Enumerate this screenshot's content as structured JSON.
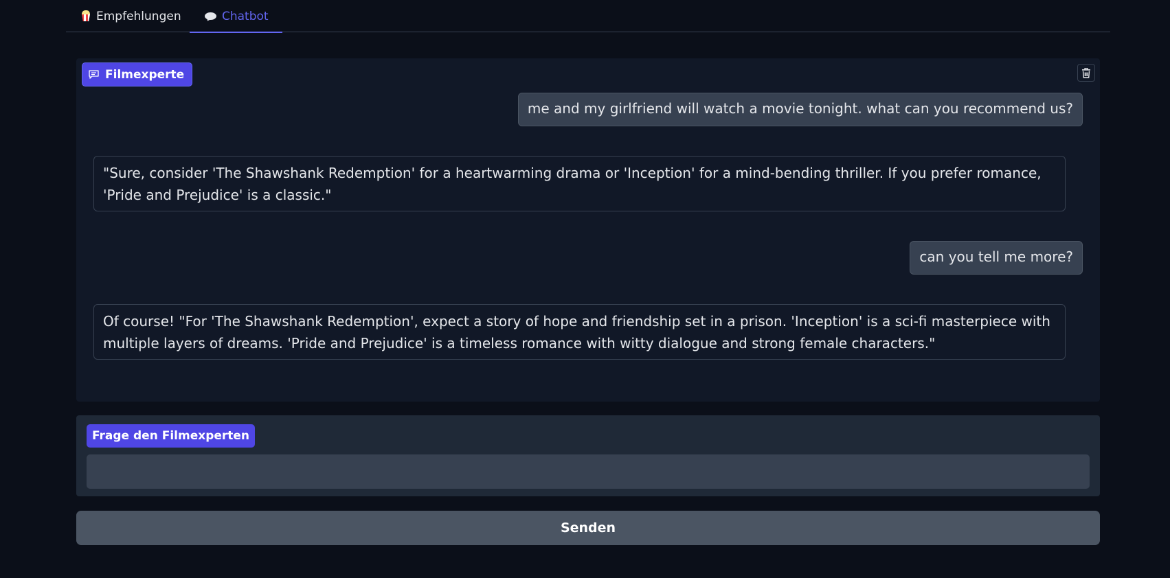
{
  "tabs": [
    {
      "label": "Empfehlungen",
      "icon": "popcorn-icon",
      "active": false
    },
    {
      "label": "Chatbot",
      "icon": "speech-bubble-icon",
      "active": true
    }
  ],
  "chatbot": {
    "label": "Filmexperte",
    "label_icon": "chat-icon",
    "clear_icon": "trash-icon",
    "messages": [
      {
        "role": "user",
        "text": "me and my girlfriend will watch a movie tonight. what can you recommend us?"
      },
      {
        "role": "bot",
        "text": "\"Sure, consider 'The Shawshank Redemption' for a heartwarming drama or 'Inception' for a mind-bending thriller. If you prefer romance, 'Pride and Prejudice' is a classic.\""
      },
      {
        "role": "user",
        "text": "can you tell me more?"
      },
      {
        "role": "bot",
        "text": "Of course! \"For 'The Shawshank Redemption', expect a story of hope and friendship set in a prison. 'Inception' is a sci-fi masterpiece with multiple layers of dreams. 'Pride and Prejudice' is a timeless romance with witty dialogue and strong female characters.\""
      }
    ]
  },
  "question": {
    "label": "Frage den Filmexperten",
    "value": ""
  },
  "send_button": {
    "label": "Senden"
  },
  "colors": {
    "background": "#0b0f19",
    "panel": "#111827",
    "accent": "#6366f1",
    "label_bg": "#4f46e5",
    "user_bubble": "#374151",
    "send_button": "#4b5563"
  }
}
